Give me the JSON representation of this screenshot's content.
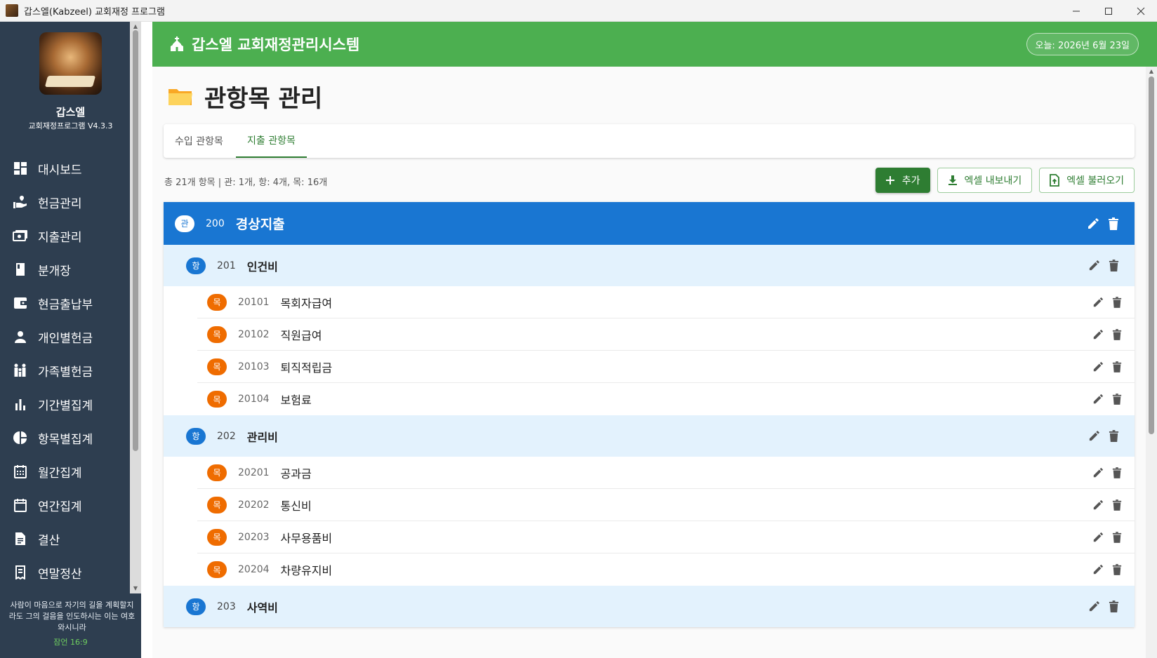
{
  "window": {
    "title": "갑스엘(Kabzeel) 교회재정 프로그램",
    "minimize_icon": "minimize-icon",
    "maximize_icon": "maximize-icon",
    "close_icon": "close-icon"
  },
  "sidebar": {
    "brand_name": "갑스엘",
    "brand_version": "교회재정프로그램 V4.3.3",
    "items": [
      {
        "label": "대시보드",
        "icon": "dashboard-icon"
      },
      {
        "label": "헌금관리",
        "icon": "offering-icon"
      },
      {
        "label": "지출관리",
        "icon": "expense-icon"
      },
      {
        "label": "분개장",
        "icon": "book-icon"
      },
      {
        "label": "현금출납부",
        "icon": "wallet-icon"
      },
      {
        "label": "개인별헌금",
        "icon": "person-icon"
      },
      {
        "label": "가족별헌금",
        "icon": "family-icon"
      },
      {
        "label": "기간별집계",
        "icon": "bar-chart-icon"
      },
      {
        "label": "항목별집계",
        "icon": "pie-chart-icon"
      },
      {
        "label": "월간집계",
        "icon": "calendar-month-icon"
      },
      {
        "label": "연간집계",
        "icon": "calendar-icon"
      },
      {
        "label": "결산",
        "icon": "document-icon"
      },
      {
        "label": "연말정산",
        "icon": "receipt-icon"
      }
    ],
    "verse": "사람이 마음으로 자기의 길을 계획할지라도 그의 걸음을 인도하시는 이는 여호와시니라",
    "verse_ref": "잠언 16:9"
  },
  "header": {
    "title": "갑스엘 교회재정관리시스템",
    "date": "오늘: 2026년 6월 23일"
  },
  "page": {
    "title": "관항목 관리",
    "tabs": [
      {
        "label": "수입 관항목",
        "active": false
      },
      {
        "label": "지출 관항목",
        "active": true
      }
    ],
    "summary": "총 21개 항목 | 관: 1개, 항: 4개, 목: 16개",
    "buttons": {
      "add": "추가",
      "export": "엑셀 내보내기",
      "import": "엑셀 불러오기"
    }
  },
  "badges": {
    "gwan": "관",
    "hang": "항",
    "mok": "목"
  },
  "tree": {
    "gwan": {
      "code": "200",
      "name": "경상지출"
    },
    "hangs": [
      {
        "code": "201",
        "name": "인건비",
        "moks": [
          {
            "code": "20101",
            "name": "목회자급여"
          },
          {
            "code": "20102",
            "name": "직원급여"
          },
          {
            "code": "20103",
            "name": "퇴직적립금"
          },
          {
            "code": "20104",
            "name": "보험료"
          }
        ]
      },
      {
        "code": "202",
        "name": "관리비",
        "moks": [
          {
            "code": "20201",
            "name": "공과금"
          },
          {
            "code": "20202",
            "name": "통신비"
          },
          {
            "code": "20203",
            "name": "사무용품비"
          },
          {
            "code": "20204",
            "name": "차량유지비"
          }
        ]
      },
      {
        "code": "203",
        "name": "사역비",
        "moks": []
      }
    ]
  },
  "colors": {
    "header_green": "#4caf50",
    "sidebar_bg": "#2e3e50",
    "gwan_blue": "#1976d2",
    "hang_bg": "#e3f2fd",
    "mok_orange": "#ef6c00",
    "primary_green": "#2e7d32"
  }
}
